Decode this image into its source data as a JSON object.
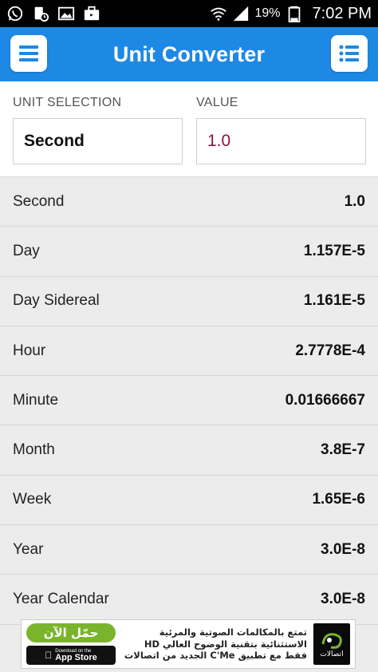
{
  "status_bar": {
    "battery_percent": "19%",
    "time": "7:02 PM",
    "left_icons": [
      "whatsapp-icon",
      "sim-clock-icon",
      "gallery-icon",
      "briefcase-icon"
    ],
    "right_icons": [
      "wifi-icon",
      "signal-icon",
      "battery-icon"
    ]
  },
  "app_bar": {
    "title": "Unit Converter",
    "left_button_icon": "hamburger-menu-icon",
    "right_button_icon": "list-icon",
    "color": "#1e88e5"
  },
  "selection": {
    "unit_label": "UNIT SELECTION",
    "unit_value": "Second",
    "value_label": "VALUE",
    "value_input": "1.0",
    "value_color": "#8b1538"
  },
  "results": [
    {
      "unit": "Second",
      "value": "1.0"
    },
    {
      "unit": "Day",
      "value": "1.157E-5"
    },
    {
      "unit": "Day Sidereal",
      "value": "1.161E-5"
    },
    {
      "unit": "Hour",
      "value": "2.7778E-4"
    },
    {
      "unit": "Minute",
      "value": "0.01666667"
    },
    {
      "unit": "Month",
      "value": "3.8E-7"
    },
    {
      "unit": "Week",
      "value": "1.65E-6"
    },
    {
      "unit": "Year",
      "value": "3.0E-8"
    },
    {
      "unit": "Year Calendar",
      "value": "3.0E-8"
    }
  ],
  "ad": {
    "cta": "حمّل الآن",
    "store_small": "Download on the",
    "store_name": "App Store",
    "line1": "تمتع بالمكالمات الصوتية والمرئية",
    "line2": "الاستثنائية بتقنية الوضوح العالي HD",
    "line3": "فقط مع تطبيق C'Me الجديد من اتصالات",
    "logo_text": "اتصالات",
    "accent": "#7ab42c"
  }
}
